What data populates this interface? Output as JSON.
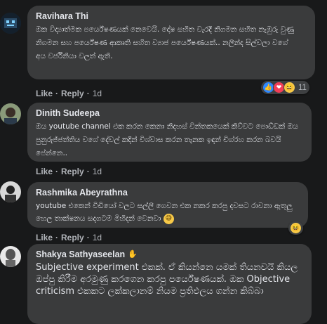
{
  "comments": [
    {
      "author": "Ravihara Thi",
      "text": "ඔක විද්‍යාත්මක පර්යේෂණයක් නෙවෙයි. දෝෂ සහිත වැරදි නිගමන සහිත නැඹුරු වුණු නිගමන සහ පර්යේෂණ ආකෘති සහිත ව්‍යාජ පර්යේෂණයක්.. නලින්ද සිල්වලා වගේ අය වර්ජිනියා වලත් ඇති.",
      "actions": {
        "like": "Like",
        "reply": "Reply",
        "sep": "·",
        "time": "1d"
      },
      "reactions": {
        "icons": [
          "like-icon",
          "love-icon",
          "haha-icon"
        ],
        "count": "11"
      }
    },
    {
      "author": "Dinith Sudeepa",
      "text": "ඔය youtube channel එක කරන කෙනා නිදහස් චින්තකයෙක් කිව්වට පොඩ්ඩක් ඔය පුනුරුජ්ජත්තිය වගේ දේවල් කදින් විශ්වාස කරන තැනක ඉඳන් චිග්රහ කරන බවයි පේන්නෙ..",
      "actions": {
        "like": "Like",
        "reply": "Reply",
        "sep": "·",
        "time": "1d"
      }
    },
    {
      "author": "Rashmika Abeyrathna",
      "text": "youtube එකෙන් විඩියෝ වලට සල්ලි ගෙවන එක නකර කරපු දවසට රාවනා ඇතුලු හෙල තාක්ෂනය සදගටම මිහිදන් වෙනවා",
      "actions": {
        "like": "Like",
        "reply": "Reply",
        "sep": "·",
        "time": "1d"
      },
      "reactions": {
        "icons": [
          "haha-icon"
        ],
        "count": ""
      }
    },
    {
      "author": "Shakya Sathyaseelan",
      "text": "Subjective experiment එකක්. ඒ කියන්නෙ යමක් තියනවයි කියල ඔප්පු කිරීම අරමුණු කරගෙන කරපු පර්යේෂණයක්. ඔක Objective criticism එකකට ලක්කලානම් නියම ප්‍රතිඵලය ගන්න කිබ්බා",
      "actions": {
        "like": "Like",
        "reply": "Reply",
        "sep": "·",
        "time": "1d"
      }
    }
  ],
  "colors": {
    "background": "#18191a",
    "bubble": "#3a3b3c",
    "text": "#e4e6eb",
    "secondary": "#b0b3b8",
    "like": "#2d88ff",
    "love": "#f33e58",
    "haha": "#f7c948"
  }
}
